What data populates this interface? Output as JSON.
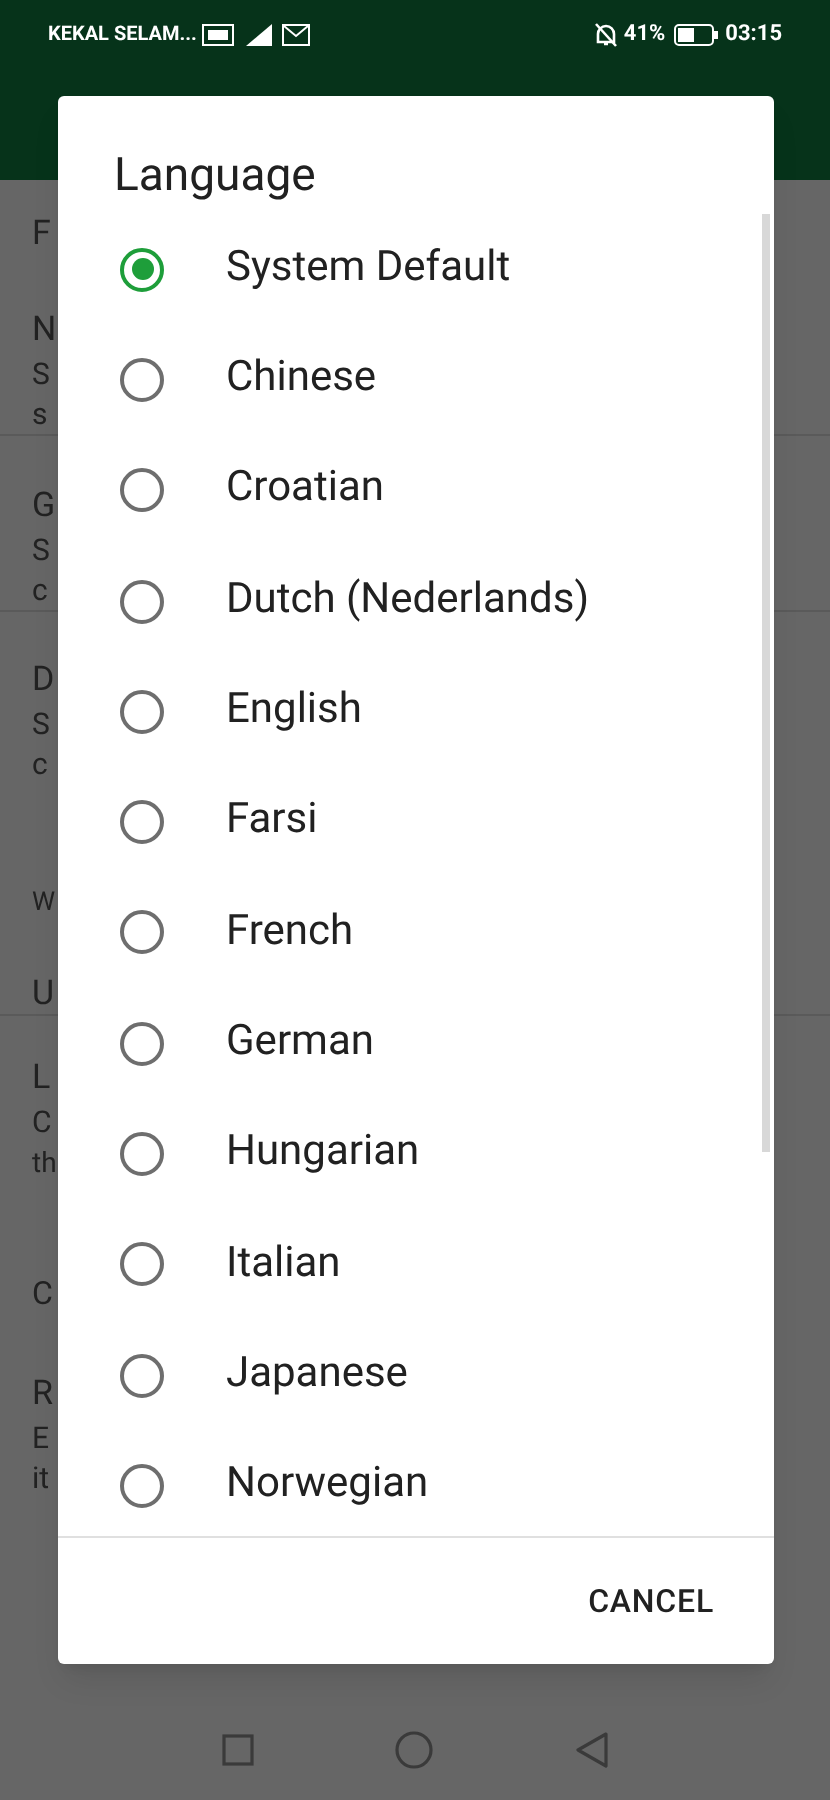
{
  "status_bar": {
    "carrier": "KEKAL SELAM...",
    "battery": "41%",
    "time": "03:15"
  },
  "background_lines": [
    "F",
    "N",
    "S",
    "s",
    "G",
    "S",
    "c",
    "D",
    "S",
    "c",
    "W",
    "U",
    "L",
    "C",
    "th",
    "C",
    "R",
    "E",
    "it"
  ],
  "dialog": {
    "title": "Language",
    "options": [
      {
        "label": "System Default",
        "selected": true
      },
      {
        "label": "Chinese",
        "selected": false
      },
      {
        "label": "Croatian",
        "selected": false
      },
      {
        "label": "Dutch (Nederlands)",
        "selected": false
      },
      {
        "label": "English",
        "selected": false
      },
      {
        "label": "Farsi",
        "selected": false
      },
      {
        "label": "French",
        "selected": false
      },
      {
        "label": "German",
        "selected": false
      },
      {
        "label": "Hungarian",
        "selected": false
      },
      {
        "label": "Italian",
        "selected": false
      },
      {
        "label": "Japanese",
        "selected": false
      },
      {
        "label": "Norwegian",
        "selected": false
      }
    ],
    "buttons": [
      "CANCEL"
    ]
  }
}
